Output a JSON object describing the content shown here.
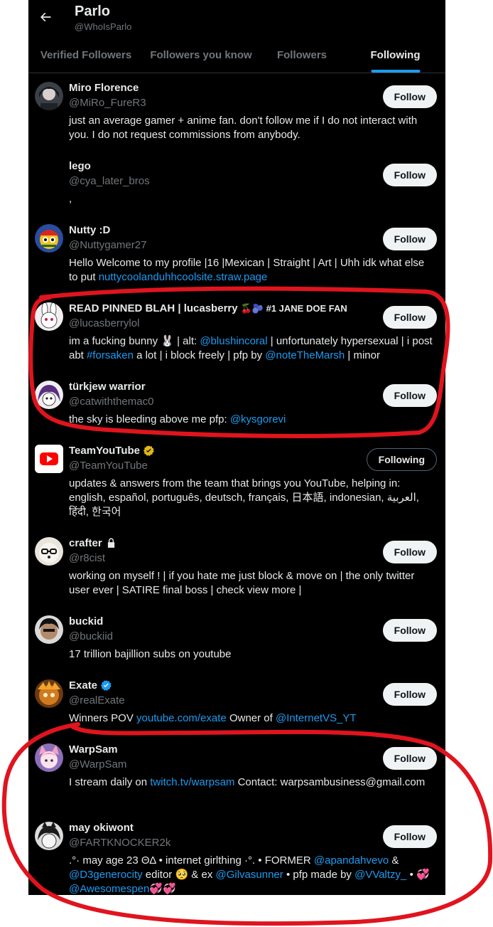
{
  "header": {
    "title": "Parlo",
    "handle": "@WhoIsParlo"
  },
  "tabs": [
    {
      "label": "Verified Followers"
    },
    {
      "label": "Followers you know"
    },
    {
      "label": "Followers"
    },
    {
      "label": "Following"
    }
  ],
  "users": [
    {
      "name": "Miro Florence",
      "username": "@MiRo_FureR3",
      "button": "Follow",
      "bio": [
        "just an average gamer + anime fan. don't follow me if I do not interact with you. I do not request commissions from anybody."
      ]
    },
    {
      "name": "lego",
      "username": "@cya_later_bros",
      "button": "Follow",
      "bio": [
        ","
      ]
    },
    {
      "name": "Nutty :D",
      "username": "@Nuttygamer27",
      "button": "Follow",
      "bio": [
        "Hello Welcome to my profile |16 |Mexican | Straight | Art | Uhh idk what else to put ",
        "nuttycoolanduhhcoolsite.straw.page"
      ]
    },
    {
      "name": "READ PINNED BLAH | lucasberry",
      "name_suffix": "🍒🫐 #1 JANE DOE FAN",
      "username": "@lucasberrylol",
      "button": "Follow",
      "bio": [
        "im a fucking bunny 🐰 | alt: ",
        "@blushincoral",
        " | unfortunately hypersexual | i post abt ",
        "#forsaken",
        " a lot | i block freely | pfp by ",
        "@noteTheMarsh",
        " | minor"
      ]
    },
    {
      "name": "türkjew warrior",
      "username": "@catwiththemac0",
      "button": "Follow",
      "bio": [
        "the sky is bleeding above me pfp: ",
        "@kysgorevi"
      ]
    },
    {
      "name": "TeamYouTube",
      "username": "@TeamYouTube",
      "button": "Following",
      "bio": [
        "updates & answers from the team that brings you YouTube, helping in: english, español, português, deutsch, français, 日本語, indonesian, العربية, हिंदी, 한국어"
      ]
    },
    {
      "name": "crafter",
      "username": "@r8cist",
      "button": "Follow",
      "bio": [
        "working on myself ! | if you hate me just block & move on | the only twitter user ever | SATIRE final boss | check view more |"
      ]
    },
    {
      "name": "buckid",
      "username": "@buckiid",
      "button": "Follow",
      "bio": [
        "17 trillion bajillion subs on youtube"
      ]
    },
    {
      "name": "Exate",
      "username": "@realExate",
      "button": "Follow",
      "bio": [
        "Winners POV ",
        "youtube.com/exate",
        " Owner of ",
        "@InternetVS_YT"
      ]
    },
    {
      "name": "WarpSam",
      "username": "@WarpSam",
      "button": "Follow",
      "bio": [
        "I stream daily on ",
        "twitch.tv/warpsam",
        " Contact: warpsambusiness@gmail.com"
      ]
    },
    {
      "name": "may okiwont",
      "username": "@FARTKNOCKER2k",
      "button": "Follow",
      "bio": [
        ".°· may age 23 ΘΔ • internet girlthing ·°. • FORMER ",
        "@apandahvevo",
        " & ",
        "@D3generocity",
        " editor 🥺 & ex ",
        "@Gilvasunner",
        " • pfp made by ",
        "@VValtzy_",
        " • 💞",
        "@Awesomespen",
        "💞💞"
      ]
    }
  ],
  "colors": {
    "background": "#000000",
    "text": "#e7e9ea",
    "muted": "#71767b",
    "accent": "#1d9bf0",
    "annotation": "#e0141e"
  }
}
